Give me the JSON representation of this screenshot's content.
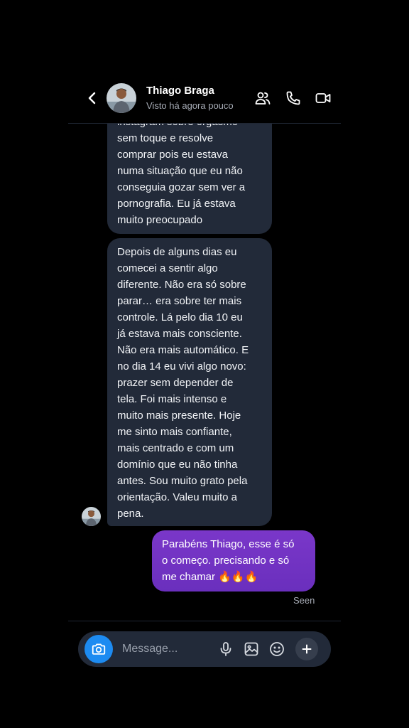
{
  "header": {
    "name": "Thiago Braga",
    "status": "Visto há agora pouco"
  },
  "messages": {
    "first_lines": [
      "instagram sobre orgasmo",
      "sem toque e resolve",
      "comprar pois eu estava",
      "numa situação que eu não",
      "conseguia gozar sem ver a",
      "pornografia. Eu já estava",
      "muito preocupado"
    ],
    "second_lines": [
      "Depois de alguns dias eu",
      "comecei a sentir algo",
      "diferente. Não era só sobre",
      "parar… era sobre ter mais",
      "controle. Lá pelo dia 10 eu",
      "já estava mais consciente.",
      "Não era mais automático. E",
      "no dia 14 eu vivi algo novo:",
      "prazer sem depender de",
      "tela. Foi mais intenso e",
      "muito mais presente. Hoje",
      "me sinto mais confiante,",
      "mais centrado e com um",
      "domínio que eu não tinha",
      "antes. Sou muito grato pela",
      "orientação. Valeu muito a",
      "pena."
    ],
    "reply_lines": [
      "Parabéns Thiago, esse é só",
      "o começo. precisando e só",
      "me chamar 🔥🔥🔥"
    ],
    "seen_label": "Seen"
  },
  "composer": {
    "placeholder": "Message..."
  },
  "icons": {
    "back": "chevron-left-icon",
    "people": "people-icon",
    "call": "phone-icon",
    "video": "video-icon",
    "camera": "camera-icon",
    "mic": "mic-icon",
    "gallery": "image-icon",
    "sticker": "smiley-icon",
    "plus": "plus-icon"
  },
  "colors": {
    "background": "#000000",
    "incoming_bubble": "#222a39",
    "outgoing_bubble": "#7a37c9",
    "camera_button": "#1d8bf1",
    "muted_text": "#a7acb6"
  }
}
